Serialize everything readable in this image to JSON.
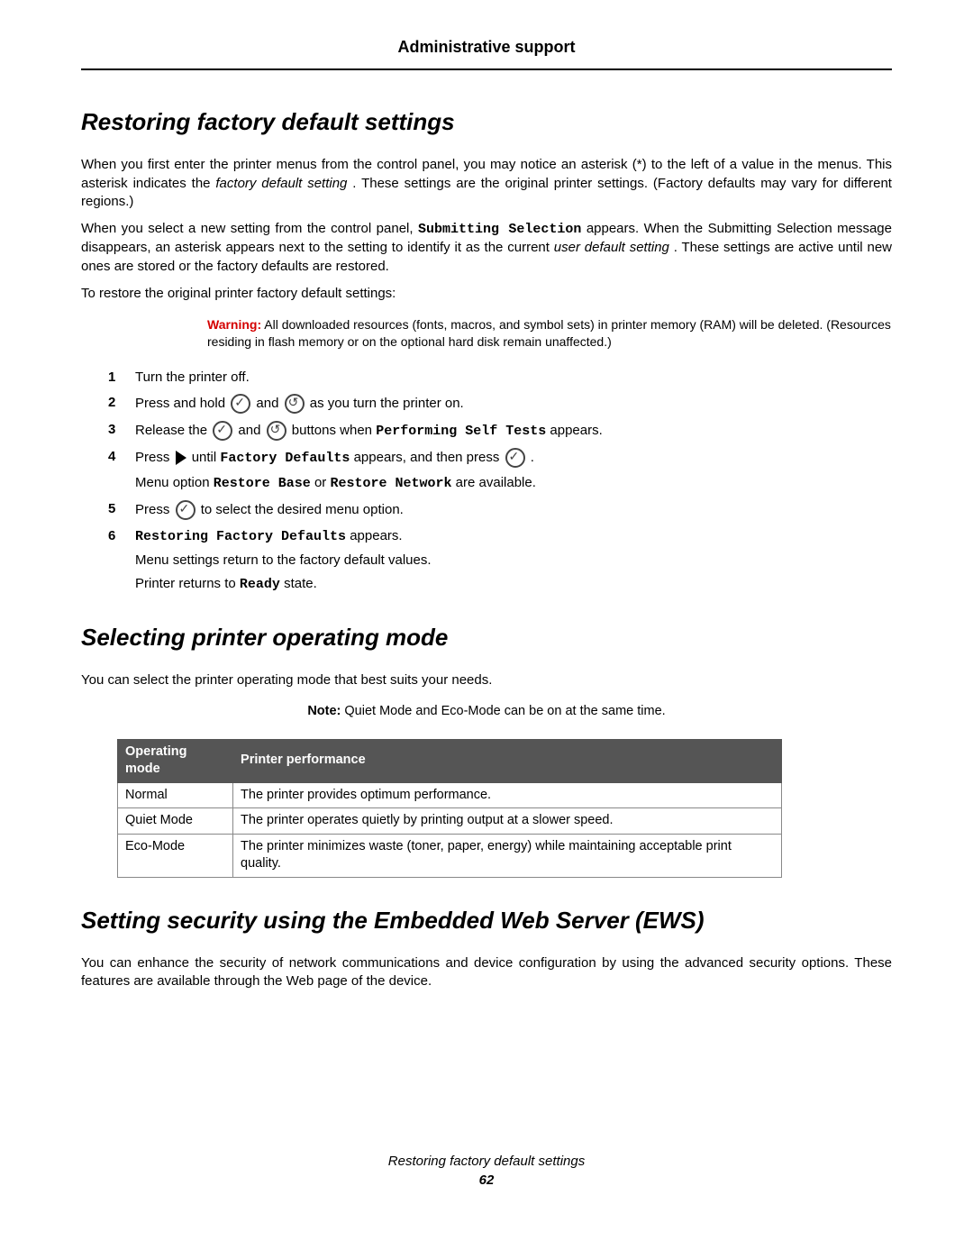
{
  "header": {
    "title": "Administrative support"
  },
  "section1": {
    "heading": "Restoring factory default settings",
    "para1_pre": "When you first enter the printer menus from the control panel, you may notice an asterisk (*) to the left of a value in the menus. This asterisk indicates the ",
    "para1_em": "factory default setting",
    "para1_post": ". These settings are the original printer settings. (Factory defaults may vary for different regions.)",
    "para2_pre": "When you select a new setting from the control panel, ",
    "para2_code": "Submitting Selection",
    "para2_mid": " appears. When the Submitting Selection message disappears, an asterisk appears next to the setting to identify it as the current ",
    "para2_em": "user default setting",
    "para2_post": ". These settings are active until new ones are stored or the factory defaults are restored.",
    "para3": "To restore the original printer factory default settings:",
    "warning_label": "Warning:",
    "warning_text": " All downloaded resources (fonts, macros, and symbol sets) in printer memory (RAM) will be deleted. (Resources residing in flash memory or on the optional hard disk remain unaffected.)",
    "steps": {
      "s1": "Turn the printer off.",
      "s2_pre": "Press and hold ",
      "s2_mid": " and ",
      "s2_post": " as you turn the printer on.",
      "s3_pre": "Release the ",
      "s3_mid": " and ",
      "s3_post1": " buttons when ",
      "s3_code": "Performing Self Tests",
      "s3_post2": " appears.",
      "s4_pre": "Press ",
      "s4_mid1": " until ",
      "s4_code": "Factory Defaults",
      "s4_mid2": " appears, and then press ",
      "s4_post": ".",
      "s4_sub_pre": "Menu option ",
      "s4_sub_code1": "Restore Base",
      "s4_sub_mid": " or ",
      "s4_sub_code2": "Restore Network",
      "s4_sub_post": " are available.",
      "s5_pre": "Press ",
      "s5_post": " to select the desired menu option.",
      "s6_code": "Restoring Factory Defaults",
      "s6_post": " appears.",
      "s6_sub1": "Menu settings return to the factory default values.",
      "s6_sub2_pre": "Printer returns to ",
      "s6_sub2_code": "Ready",
      "s6_sub2_post": " state."
    }
  },
  "section2": {
    "heading": "Selecting printer operating mode",
    "para1": "You can select the printer operating mode that best suits your needs.",
    "note_label": "Note:",
    "note_text": " Quiet Mode and Eco-Mode can be on at the same time.",
    "table": {
      "headers": [
        "Operating mode",
        "Printer performance"
      ],
      "rows": [
        {
          "mode": "Normal",
          "perf": "The printer provides optimum performance."
        },
        {
          "mode": "Quiet Mode",
          "perf": "The printer operates quietly by printing output at a slower speed."
        },
        {
          "mode": "Eco-Mode",
          "perf": "The printer minimizes waste (toner, paper, energy) while maintaining acceptable print quality."
        }
      ]
    }
  },
  "section3": {
    "heading": "Setting security using the Embedded Web Server (EWS)",
    "para1": "You can enhance the security of network communications and device configuration by using the advanced security options. These features are available through the Web page of the device."
  },
  "footer": {
    "title": "Restoring factory default settings",
    "page": "62"
  }
}
